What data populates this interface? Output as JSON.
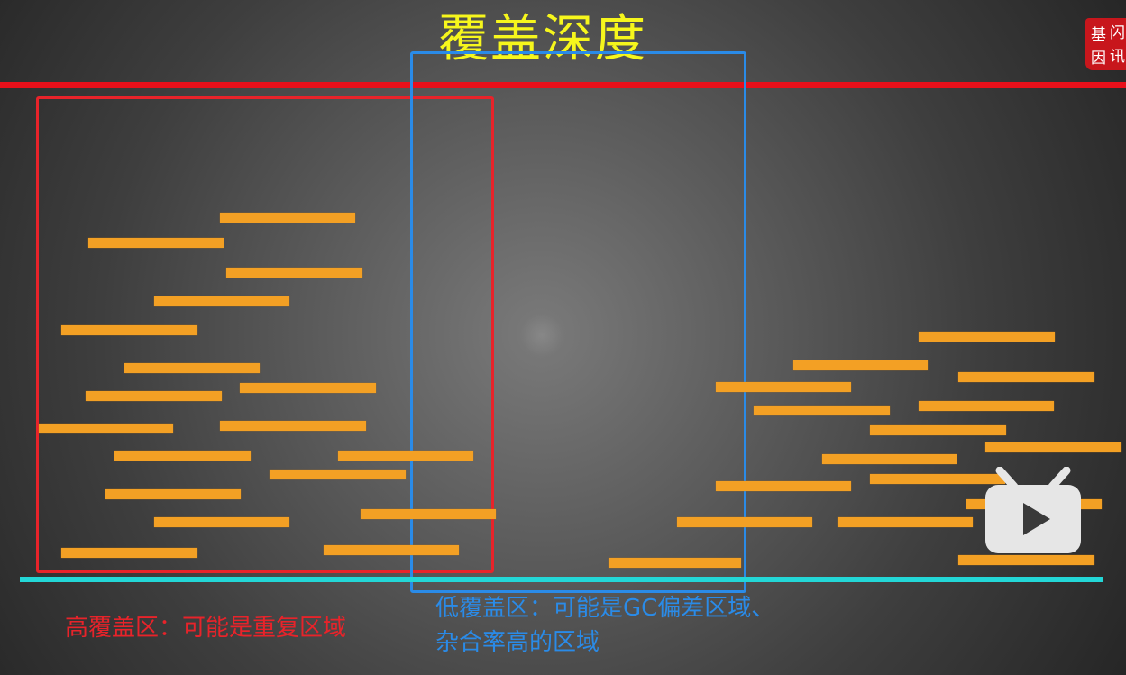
{
  "title": "覆盖深度",
  "labels": {
    "high": "高覆盖区：可能是重复区域",
    "low_line1": "低覆盖区：可能是GC偏差区域、",
    "low_line2": "杂合率高的区域"
  },
  "seal": {
    "chars": [
      "基",
      "因",
      "闪",
      "讯"
    ]
  },
  "logo": {
    "name": "tv-play-icon"
  },
  "colors": {
    "title": "#f6f61c",
    "reference_line": "#e8101a",
    "baseline": "#23d7d7",
    "high_box": "#e8232a",
    "low_box": "#2a8be8",
    "reads": "#f3a024"
  }
}
